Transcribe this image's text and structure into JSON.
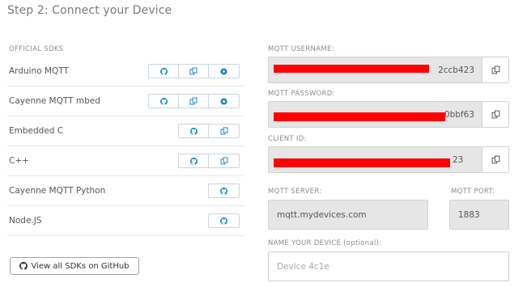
{
  "page": {
    "step_title": "Step 2: Connect your Device"
  },
  "sdks": {
    "section_label": "OFFICIAL SDKS",
    "items": [
      {
        "name": "Arduino MQTT"
      },
      {
        "name": "Cayenne MQTT mbed"
      },
      {
        "name": "Embedded C"
      },
      {
        "name": "C++"
      },
      {
        "name": "Cayenne MQTT Python"
      },
      {
        "name": "Node.JS"
      }
    ],
    "github_button": "View all SDKs on GitHub"
  },
  "credentials": {
    "username": {
      "label": "MQTT USERNAME:",
      "value_suffix": "2ccb423"
    },
    "password": {
      "label": "MQTT PASSWORD:",
      "value_suffix": "0bbf63"
    },
    "client_id": {
      "label": "CLIENT ID:",
      "value_suffix": "23"
    },
    "server": {
      "label": "MQTT SERVER:",
      "value": "mqtt.mydevices.com"
    },
    "port": {
      "label": "MQTT PORT:",
      "value": "1883"
    },
    "device_name": {
      "label": "NAME YOUR DEVICE (optional):",
      "placeholder": "Device 4c1e"
    }
  },
  "colors": {
    "accent": "#1e88c8",
    "redaction": "#ff0000"
  }
}
